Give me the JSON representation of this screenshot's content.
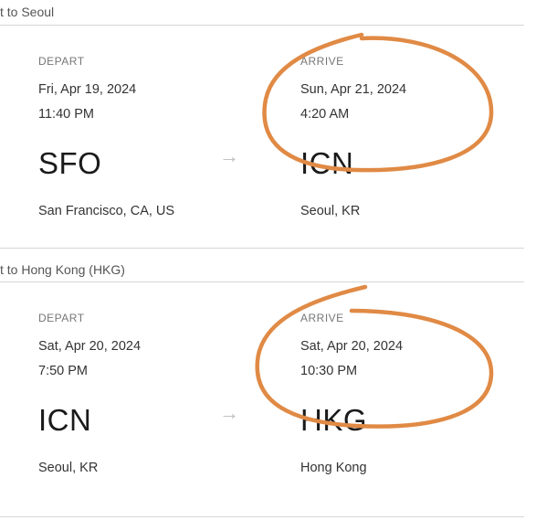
{
  "flights": [
    {
      "title": "t to Seoul",
      "depart": {
        "label": "DEPART",
        "date": "Fri, Apr 19, 2024",
        "time": "11:40 PM",
        "code": "SFO",
        "city": "San Francisco, CA, US"
      },
      "arrow": "→",
      "arrive": {
        "label": "ARRIVE",
        "date": "Sun, Apr 21, 2024",
        "time": "4:20 AM",
        "code": "ICN",
        "city": "Seoul, KR"
      }
    },
    {
      "title": "t to Hong Kong (HKG)",
      "depart": {
        "label": "DEPART",
        "date": "Sat, Apr 20, 2024",
        "time": "7:50 PM",
        "code": "ICN",
        "city": "Seoul, KR"
      },
      "arrow": "→",
      "arrive": {
        "label": "ARRIVE",
        "date": "Sat, Apr 20, 2024",
        "time": "10:30 PM",
        "code": "HKG",
        "city": "Hong Kong"
      }
    }
  ],
  "annotation_color": "#E08A45"
}
